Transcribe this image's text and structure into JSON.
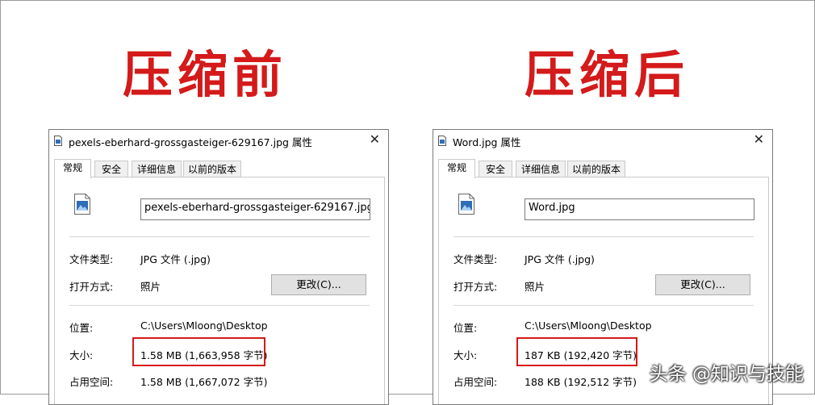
{
  "headings": {
    "before": "压缩前",
    "after": "压缩后"
  },
  "labels": {
    "file_type": "文件类型:",
    "opens_with": "打开方式:",
    "location": "位置:",
    "size": "大小:",
    "size_on_disk": "占用空间:"
  },
  "tabs": [
    "常规",
    "安全",
    "详细信息",
    "以前的版本"
  ],
  "close_glyph": "✕",
  "dialogs": [
    {
      "title": "pexels-eberhard-grossgasteiger-629167.jpg 属性",
      "filename": "pexels-eberhard-grossgasteiger-629167.jpg",
      "file_type": "JPG 文件 (.jpg)",
      "opens_with": "照片",
      "change_button": "更改(C)...",
      "location": "C:\\Users\\Mloong\\Desktop",
      "size": "1.58 MB (1,663,958 字节)",
      "size_on_disk": "1.58 MB (1,667,072 字节)"
    },
    {
      "title": "Word.jpg 属性",
      "filename": "Word.jpg",
      "file_type": "JPG 文件 (.jpg)",
      "opens_with": "照片",
      "change_button": "更改(C)...",
      "location": "C:\\Users\\Mloong\\Desktop",
      "size": "187 KB (192,420 字节)",
      "size_on_disk": "188 KB (192,512 字节)"
    }
  ],
  "watermark": "头条 @知识与技能",
  "colors": {
    "highlight": "#d41a1a",
    "heading": "#d41a1a"
  }
}
